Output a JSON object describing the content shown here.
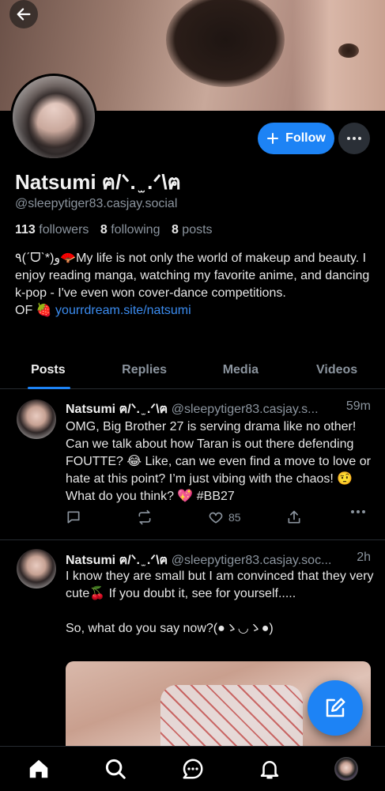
{
  "profile": {
    "display_name": "Natsumi ฅ/ᐠ. ̫ .ᐟ\\ฅ",
    "handle": "@sleepytiger83.casjay.social",
    "followers_count": "113",
    "followers_label": "followers",
    "following_count": "8",
    "following_label": "following",
    "posts_count": "8",
    "posts_label": "posts",
    "bio_line1": "٩(ˊᗜˋ*)و🪭My life is not only the world of makeup and beauty. I enjoy reading manga, watching my favorite anime, and dancing k-pop - I've even won cover-dance competitions.",
    "bio_prefix": "OF 🍓",
    "bio_link": "yourrdream.site/natsumi"
  },
  "buttons": {
    "follow_label": "Follow"
  },
  "tabs": [
    {
      "label": "Posts",
      "active": true
    },
    {
      "label": "Replies",
      "active": false
    },
    {
      "label": "Media",
      "active": false
    },
    {
      "label": "Videos",
      "active": false
    }
  ],
  "posts": [
    {
      "name": "Natsumi ฅ/ᐠ. ̫ .ᐟ\\ฅ",
      "handle": "@sleepytiger83.casjay.s...",
      "time": "59m",
      "text": "OMG, Big Brother 27 is serving drama like no other! Can we talk about how Taran is out there defending FOUTTE? 😂 Like, can we even find a move to love or hate at this point? I’m just vibing with the chaos! 🤨 What do you think? 💖 #BB27",
      "likes": "85"
    },
    {
      "name": "Natsumi ฅ/ᐠ. ̫ .ᐟ\\ฅ",
      "handle": "@sleepytiger83.casjay.soc...",
      "time": "2h",
      "text_line1": "I know they are small but I am convinced that they very cute🍒 If you doubt it, see for yourself.....",
      "text_line2": "So, what do you say now?(●ゝ◡ゝ●)"
    }
  ],
  "colors": {
    "accent": "#1d83f5",
    "background": "#000000",
    "muted_text": "#8b949e",
    "link": "#3b8cf0"
  },
  "icons": {
    "back": "arrow-left-icon",
    "more": "ellipsis-icon",
    "reply": "speech-bubble-icon",
    "repost": "repost-icon",
    "like": "heart-icon",
    "share": "share-icon",
    "compose": "pencil-icon",
    "nav": [
      "home-icon",
      "search-icon",
      "chat-icon",
      "bell-icon",
      "profile-avatar"
    ]
  }
}
